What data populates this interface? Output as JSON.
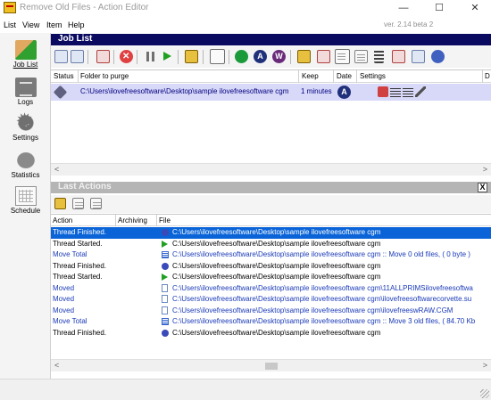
{
  "window": {
    "title": "Remove Old Files - Action Editor",
    "controls": {
      "minimize": "—",
      "maximize": "☐",
      "close": "✕"
    }
  },
  "menu": {
    "items": [
      "List",
      "View",
      "Item",
      "Help"
    ],
    "version": "ver. 2.14 beta 2"
  },
  "sidebar": {
    "items": [
      {
        "label": "Job List",
        "icon": "job-list-icon",
        "active": true
      },
      {
        "label": "Logs",
        "icon": "logs-icon"
      },
      {
        "label": "Settings",
        "icon": "settings-icon"
      },
      {
        "label": "Statistics",
        "icon": "statistics-icon"
      },
      {
        "label": "Schedule",
        "icon": "schedule-icon"
      }
    ]
  },
  "job_list": {
    "title": "Job List",
    "toolbar_icons": [
      "new-job-icon",
      "copy-job-icon",
      "delete-job-icon",
      "stop-icon",
      "pause-icon",
      "run-icon",
      "run-all-icon",
      "search-icon",
      "schedule-c-icon",
      "schedule-a-icon",
      "schedule-w-icon",
      "export-icon",
      "import-icon",
      "filter-icon",
      "grid-icon",
      "wand-icon",
      "wand-red-icon",
      "blue-icon"
    ],
    "columns": [
      "Status",
      "Folder to purge",
      "Keep",
      "Date",
      "Settings",
      "D"
    ],
    "rows": [
      {
        "status_icon": "status-diamond-icon",
        "folder": "C:\\Users\\ilovefreesoftware\\Desktop\\sample ilovefreesoftware cgm",
        "keep": "1 minutes",
        "date_glyph": "A"
      }
    ]
  },
  "last_actions": {
    "title": "Last Actions",
    "close_label": "X",
    "toolbar_icons": [
      "refresh-icon",
      "copy-log-icon",
      "clear-log-icon"
    ],
    "columns": [
      "Action",
      "Archiving",
      "File"
    ],
    "rows": [
      {
        "action": "Thread Finished.",
        "icon": "dot",
        "file": "C:\\Users\\ilovefreesoftware\\Desktop\\sample ilovefreesoftware cgm",
        "selected": true,
        "color": "black"
      },
      {
        "action": "Thread Started.",
        "icon": "play",
        "file": "C:\\Users\\ilovefreesoftware\\Desktop\\sample ilovefreesoftware cgm",
        "color": "black"
      },
      {
        "action": "Move Total",
        "icon": "lines",
        "file": "C:\\Users\\ilovefreesoftware\\Desktop\\sample ilovefreesoftware cgm :: Move 0 old files, ( 0 byte )",
        "color": "blue"
      },
      {
        "action": "Thread Finished.",
        "icon": "dot",
        "file": "C:\\Users\\ilovefreesoftware\\Desktop\\sample ilovefreesoftware cgm",
        "color": "black"
      },
      {
        "action": "Thread Started.",
        "icon": "play",
        "file": "C:\\Users\\ilovefreesoftware\\Desktop\\sample ilovefreesoftware cgm",
        "color": "black"
      },
      {
        "action": "Moved",
        "icon": "page",
        "file": "C:\\Users\\ilovefreesoftware\\Desktop\\sample ilovefreesoftware cgm\\11ALLPRIMSilovefreesoftwa",
        "color": "blue"
      },
      {
        "action": "Moved",
        "icon": "page",
        "file": "C:\\Users\\ilovefreesoftware\\Desktop\\sample ilovefreesoftware cgm\\ilovefreesoftwarecorvette.su",
        "color": "blue"
      },
      {
        "action": "Moved",
        "icon": "page",
        "file": "C:\\Users\\ilovefreesoftware\\Desktop\\sample ilovefreesoftware cgm\\ilovefreeswRAW.CGM",
        "color": "blue"
      },
      {
        "action": "Move Total",
        "icon": "lines",
        "file": "C:\\Users\\ilovefreesoftware\\Desktop\\sample ilovefreesoftware cgm :: Move 3 old files, ( 84.70 Kb",
        "color": "blue"
      },
      {
        "action": "Thread Finished.",
        "icon": "dot",
        "file": "C:\\Users\\ilovefreesoftware\\Desktop\\sample ilovefreesoftware cgm",
        "color": "black"
      }
    ]
  },
  "scroll_arrows": {
    "left": "<",
    "right": ">"
  }
}
